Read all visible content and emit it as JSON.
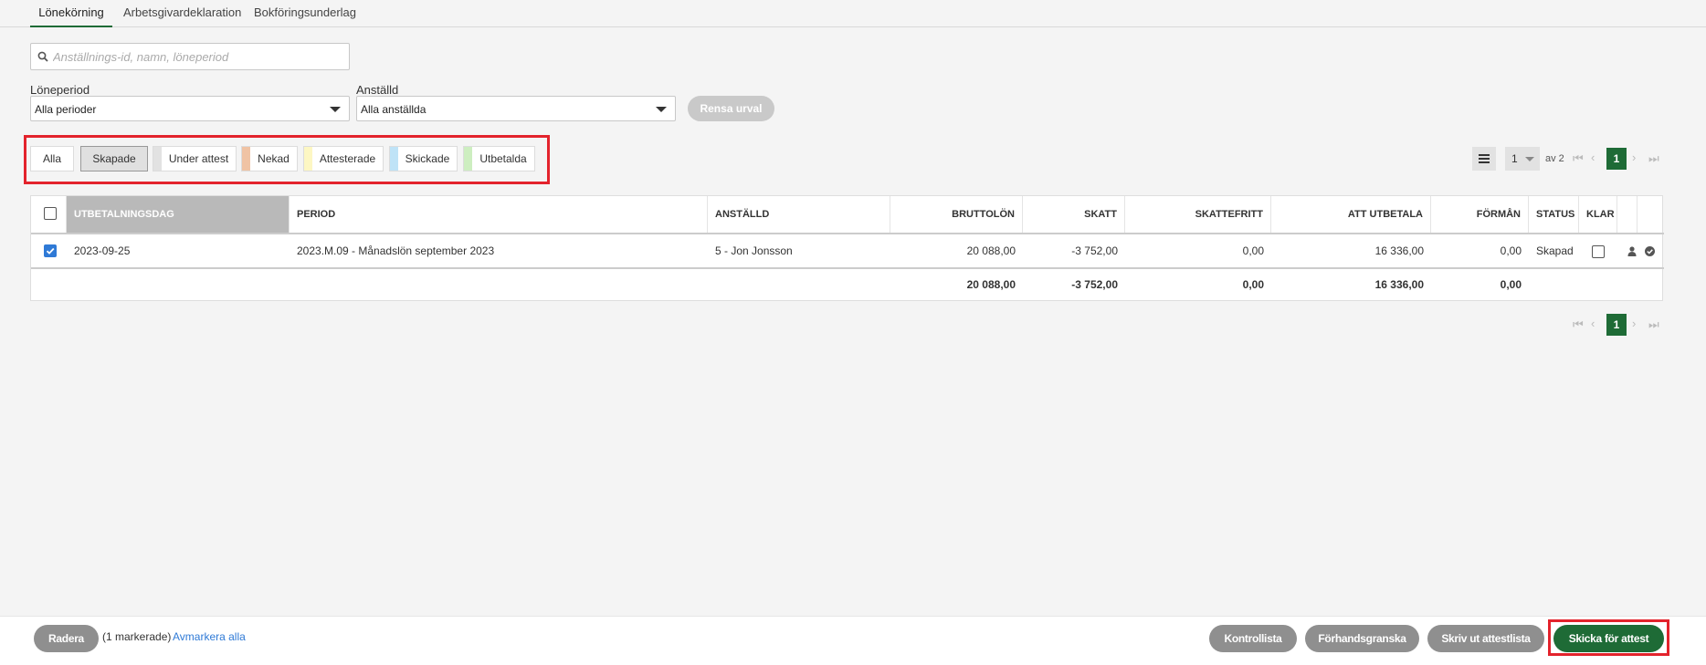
{
  "tabs": [
    {
      "label": "Lönekörning"
    },
    {
      "label": "Arbetsgivardeklaration"
    },
    {
      "label": "Bokföringsunderlag"
    }
  ],
  "search": {
    "placeholder": "Anställnings-id, namn, löneperiod"
  },
  "filters": {
    "period_label": "Löneperiod",
    "period_value": "Alla perioder",
    "employee_label": "Anställd",
    "employee_value": "Alla anställda",
    "clear_label": "Rensa urval"
  },
  "status_chips": [
    {
      "label": "Alla",
      "color": ""
    },
    {
      "label": "Skapade",
      "color": "",
      "selected": true
    },
    {
      "label": "Under attest",
      "color": "#e2e2e2"
    },
    {
      "label": "Nekad",
      "color": "#f0c3a4"
    },
    {
      "label": "Attesterade",
      "color": "#fdf7c3"
    },
    {
      "label": "Skickade",
      "color": "#bfe3f7"
    },
    {
      "label": "Utbetalda",
      "color": "#cdeec0"
    }
  ],
  "pager_top": {
    "page_size": "1",
    "of_label": "av 2",
    "current": "1"
  },
  "pager_bottom": {
    "current": "1"
  },
  "table": {
    "headers": [
      "UTBETALNINGSDAG",
      "PERIOD",
      "ANSTÄLLD",
      "BRUTTOLÖN",
      "SKATT",
      "SKATTEFRITT",
      "ATT UTBETALA",
      "FÖRMÅN",
      "STATUS",
      "KLAR"
    ],
    "rows": [
      {
        "date": "2023-09-25",
        "period": "2023.M.09 - Månadslön september 2023",
        "employee": "5 - Jon Jonsson",
        "gross": "20 088,00",
        "tax": "-3 752,00",
        "taxfree": "0,00",
        "to_pay": "16 336,00",
        "benefit": "0,00",
        "status": "Skapad"
      }
    ],
    "totals": {
      "gross": "20 088,00",
      "tax": "-3 752,00",
      "taxfree": "0,00",
      "to_pay": "16 336,00",
      "benefit": "0,00"
    }
  },
  "footer": {
    "delete_label": "Radera",
    "marked_text": "(1 markerade)",
    "unmark_link": "Avmarkera alla",
    "buttons": [
      "Kontrollista",
      "Förhandsgranska",
      "Skriv ut attestlista",
      "Skicka för attest"
    ]
  },
  "colors": {
    "accent": "#1e6b36",
    "highlight": "#e3232c",
    "link": "#2f7ad6"
  }
}
